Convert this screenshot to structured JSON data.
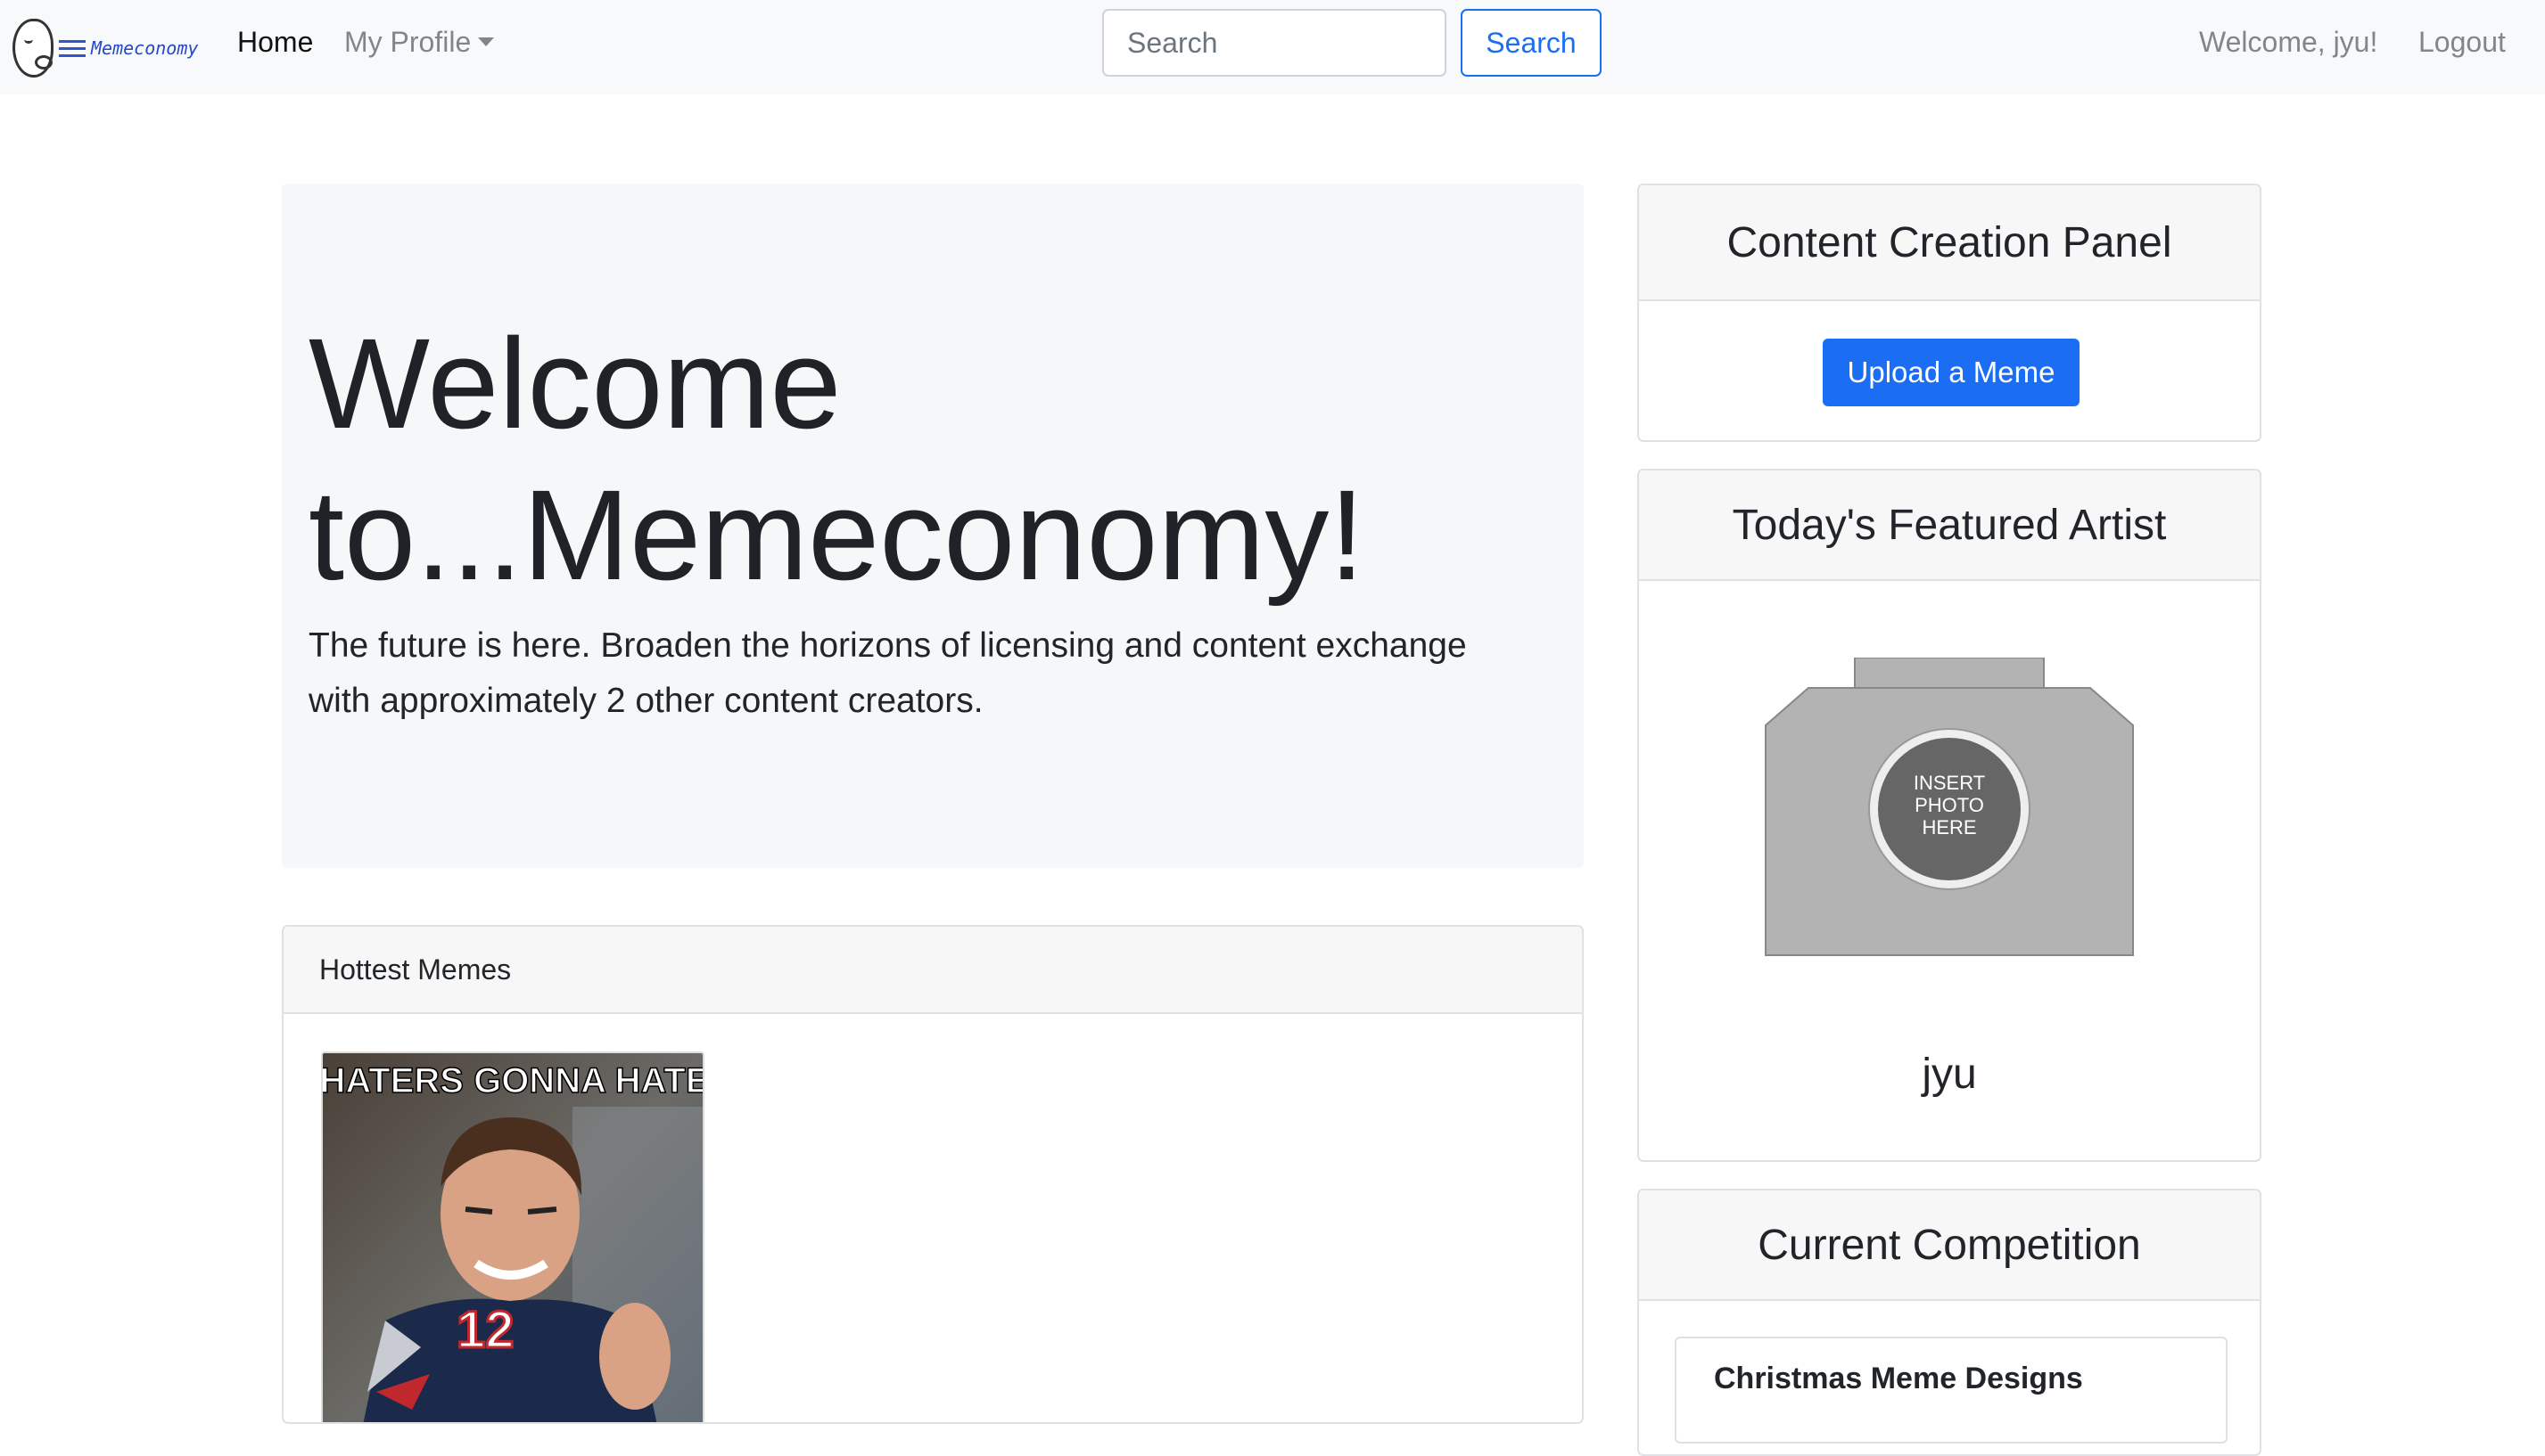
{
  "navbar": {
    "brand_text": "Memeconomy",
    "home": "Home",
    "my_profile": "My Profile",
    "search_placeholder": "Search",
    "search_button": "Search",
    "welcome": "Welcome, jyu!",
    "logout": "Logout"
  },
  "jumbotron": {
    "title": "Welcome to...Memeconomy!",
    "lead_prefix": "The future is here. Broaden the horizons of licensing and content exchange with approximately ",
    "lead_count": "2",
    "lead_suffix": " other content creators."
  },
  "hottest_memes": {
    "header": "Hottest Memes",
    "memes": [
      {
        "caption": "HATERS GONNA HATE",
        "jersey_number": "12"
      }
    ]
  },
  "content_creation_panel": {
    "title": "Content Creation Panel",
    "upload_button": "Upload a Meme"
  },
  "featured_artist": {
    "title": "Today's Featured Artist",
    "photo_placeholder_line1": "INSERT",
    "photo_placeholder_line2": "PHOTO",
    "photo_placeholder_line3": "HERE",
    "name": "jyu"
  },
  "competition": {
    "title": "Current Competition",
    "item_title": "Christmas Meme Designs"
  },
  "colors": {
    "primary": "#1b6ef3",
    "navbar_bg": "#f8f9fa",
    "jumbotron_bg": "#f6f7f9",
    "camera_gray": "#b3b3b3"
  }
}
